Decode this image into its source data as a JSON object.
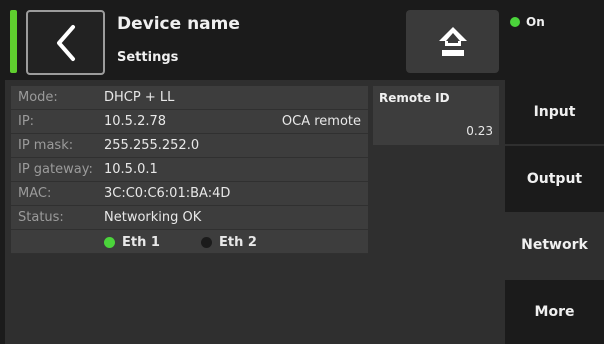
{
  "header": {
    "title": "Device name",
    "subtitle": "Settings",
    "back_icon": "chevron-left-icon",
    "home_icon": "home-icon",
    "power_status": "On",
    "accent_color": "#5fce2e",
    "power_color": "#4bd43b"
  },
  "network": {
    "rows": [
      {
        "label": "Mode:",
        "value": "DHCP + LL"
      },
      {
        "label": "IP:",
        "value": "10.5.2.78",
        "extra": "OCA remote"
      },
      {
        "label": "IP mask:",
        "value": "255.255.252.0"
      },
      {
        "label": "IP gateway:",
        "value": "10.5.0.1"
      },
      {
        "label": "MAC:",
        "value": "3C:C0:C6:01:BA:4D"
      },
      {
        "label": "Status:",
        "value": "Networking OK"
      }
    ],
    "ports": [
      {
        "name": "Eth 1",
        "status": "connected",
        "color": "#4bd43b"
      },
      {
        "name": "Eth 2",
        "status": "disconnected",
        "color": "#1b1b1b"
      }
    ]
  },
  "remote": {
    "label": "Remote ID",
    "value": "0.23"
  },
  "menu": {
    "items": [
      {
        "label": "Input",
        "active": false
      },
      {
        "label": "Output",
        "active": false
      },
      {
        "label": "Network",
        "active": true
      },
      {
        "label": "More",
        "active": false
      }
    ]
  }
}
